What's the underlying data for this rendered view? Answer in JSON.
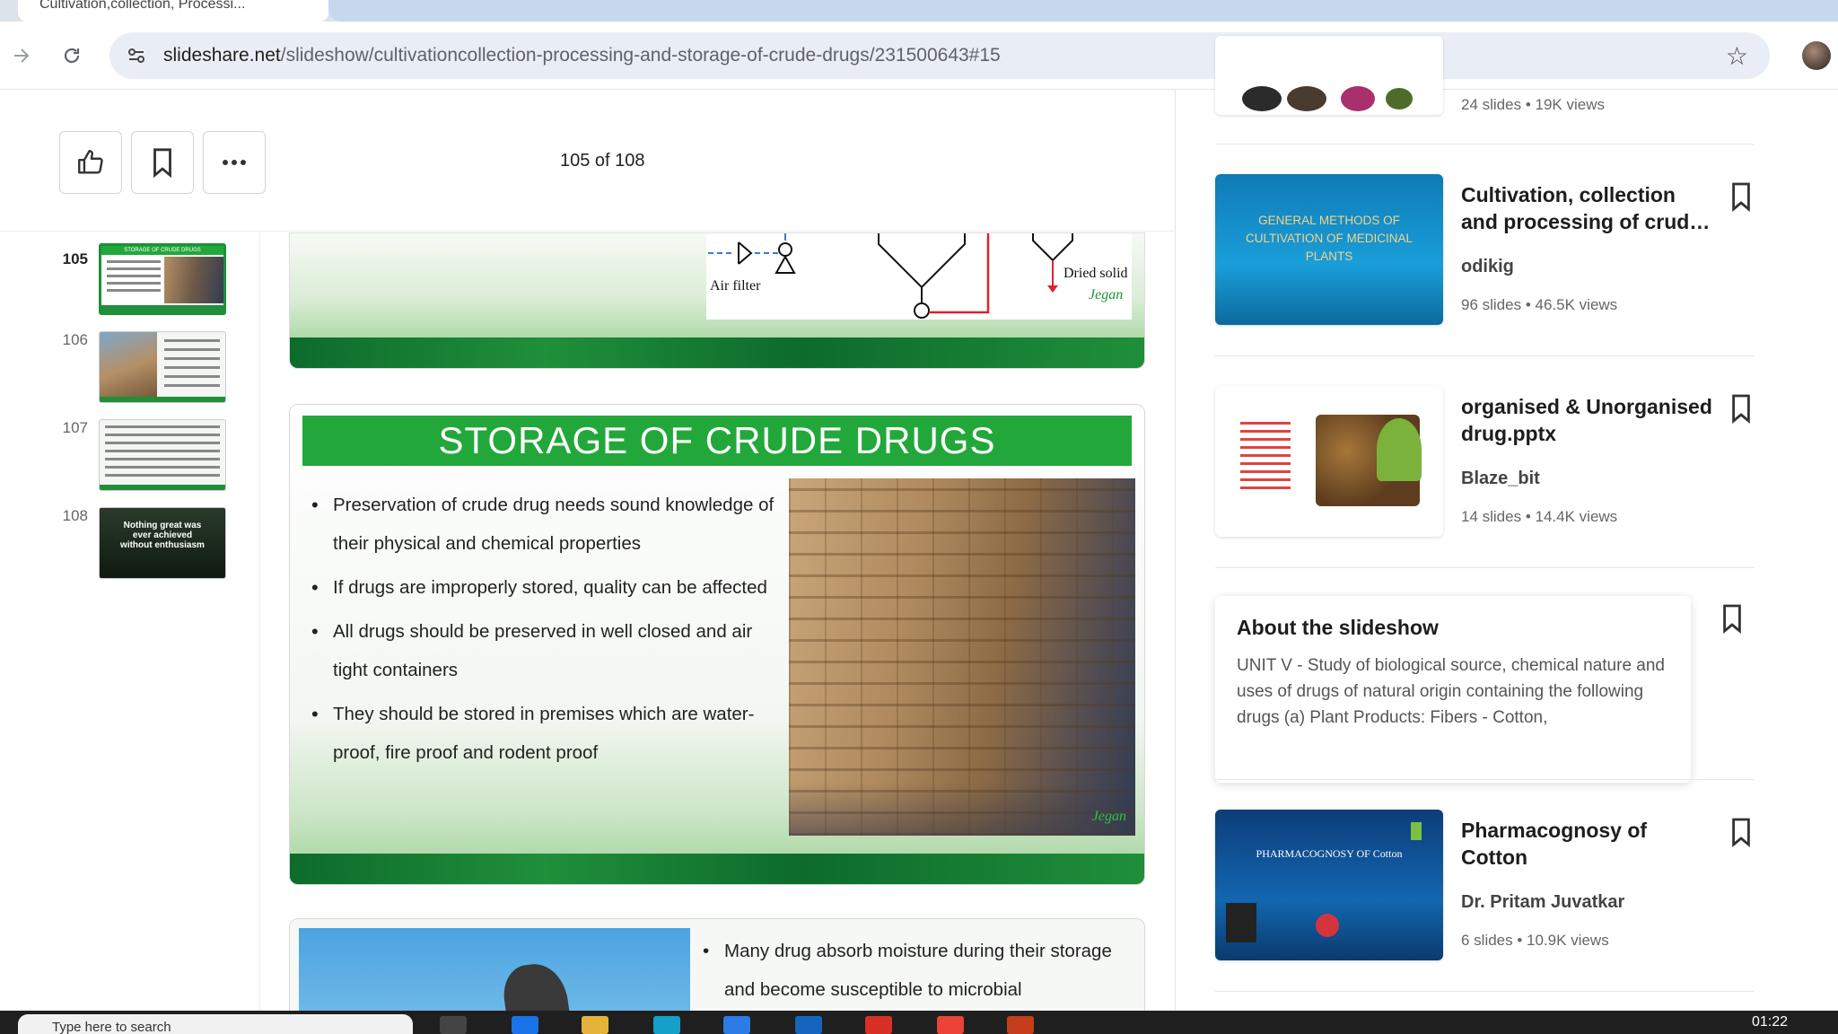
{
  "browser": {
    "tab_title": "Cultivation,collection, Processi...",
    "url_host": "slideshare.net",
    "url_path": "/slideshow/cultivationcollection-processing-and-storage-of-crude-drugs/231500643#15"
  },
  "viewer": {
    "page_counter": "105 of 108",
    "thumbnails": [
      {
        "num": "105",
        "label": "STORAGE OF CRUDE DRUGS"
      },
      {
        "num": "106",
        "label": ""
      },
      {
        "num": "107",
        "label": ""
      },
      {
        "num": "108",
        "label": "Nothing great was ever achieved without enthusiasm"
      }
    ],
    "prev_slide": {
      "air_filter": "Air filter",
      "dried_solid": "Dried solid",
      "signature": "Jegan"
    },
    "slide": {
      "title": "STORAGE OF CRUDE DRUGS",
      "bullets": [
        "Preservation of crude drug needs sound knowledge of their physical and chemical properties",
        "If drugs are improperly stored, quality can be affected",
        "All drugs should be preserved in well closed and air tight containers",
        "They should be stored in premises which are water-proof, fire proof and rodent proof"
      ],
      "signature": "Jegan"
    },
    "next_slide": {
      "bullets": [
        "Many drug absorb moisture during their storage and become susceptible to microbial"
      ]
    }
  },
  "sidebar": {
    "top_stats": {
      "slides": "24 slides",
      "views": "19K views"
    },
    "cards": [
      {
        "title": "Cultivation, collection and processing of crud…",
        "author": "odikig",
        "slides": "96 slides",
        "views": "46.5K views",
        "thumb_text": "GENERAL METHODS OF CULTIVATION OF MEDICINAL PLANTS"
      },
      {
        "title": "organised & Unorganised drug.pptx",
        "author": "Blaze_bit",
        "slides": "14 slides",
        "views": "14.4K views",
        "thumb_text": ""
      },
      {
        "title": "Pharmacognosy of Cotton",
        "author": "Dr. Pritam Juvatkar",
        "slides": "6 slides",
        "views": "10.9K views",
        "thumb_text": "PHARMACOGNOSY OF Cotton"
      }
    ],
    "about": {
      "heading": "About the slideshow",
      "text": "UNIT V - Study of biological source, chemical nature and uses of drugs of natural origin containing the following drugs (a) Plant Products: Fibers - Cotton,"
    }
  },
  "taskbar": {
    "search_placeholder": "Type here to search",
    "time": "01:22"
  },
  "colors": {
    "slide_green": "#22a83a",
    "dark_green": "#0d6b2c",
    "omnibox": "#e9eef6"
  }
}
